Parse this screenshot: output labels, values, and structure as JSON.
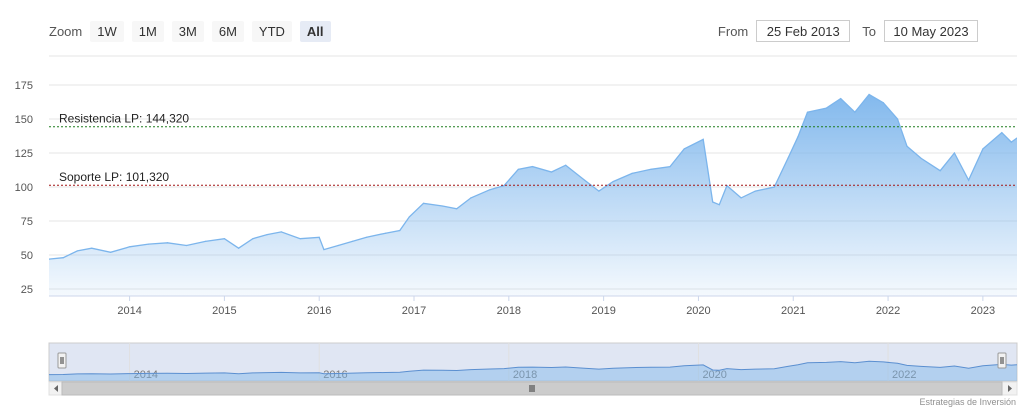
{
  "zoom": {
    "label": "Zoom",
    "buttons": [
      "1W",
      "1M",
      "3M",
      "6M",
      "YTD",
      "All"
    ],
    "active": "All"
  },
  "range": {
    "from_label": "From",
    "from_value": "25 Feb 2013",
    "to_label": "To",
    "to_value": "10 May 2023"
  },
  "credit": "Estrategias de Inversión",
  "colors": {
    "area_line": "#7cb5ec",
    "area_fill_top": "#7cb5ec",
    "resistance_line": "#1e7d1e",
    "support_line": "#a31515",
    "navigator_mask": "#c6d2ea"
  },
  "chart_data": {
    "type": "area",
    "title": "",
    "xlabel": "",
    "ylabel": "",
    "ylim": [
      25,
      175
    ],
    "yticks": [
      25,
      50,
      75,
      100,
      125,
      150,
      175
    ],
    "xlim": [
      2013.15,
      2023.36
    ],
    "xticks": [
      "2014",
      "2015",
      "2016",
      "2017",
      "2018",
      "2019",
      "2020",
      "2021",
      "2022",
      "2023"
    ],
    "grid": true,
    "series": [
      {
        "x": [
          2013.15,
          2013.3,
          2013.45,
          2013.6,
          2013.8,
          2014.0,
          2014.2,
          2014.4,
          2014.6,
          2014.8,
          2015.0,
          2015.15,
          2015.3,
          2015.45,
          2015.6,
          2015.8,
          2016.0,
          2016.05,
          2016.2,
          2016.35,
          2016.5,
          2016.7,
          2016.85,
          2016.95,
          2017.1,
          2017.3,
          2017.45,
          2017.6,
          2017.8,
          2017.95,
          2018.1,
          2018.25,
          2018.45,
          2018.6,
          2018.8,
          2018.95,
          2019.1,
          2019.3,
          2019.5,
          2019.7,
          2019.85,
          2020.05,
          2020.15,
          2020.22,
          2020.3,
          2020.45,
          2020.6,
          2020.8,
          2020.95,
          2021.05,
          2021.15,
          2021.35,
          2021.5,
          2021.65,
          2021.8,
          2021.95,
          2022.1,
          2022.2,
          2022.35,
          2022.55,
          2022.7,
          2022.85,
          2023.0,
          2023.2,
          2023.3,
          2023.36
        ],
        "values": [
          47,
          48,
          53,
          55,
          52,
          56,
          58,
          59,
          57,
          60,
          62,
          55,
          62,
          65,
          67,
          62,
          63,
          54,
          57,
          60,
          63,
          66,
          68,
          78,
          88,
          86,
          84,
          92,
          98,
          101,
          113,
          115,
          111,
          116,
          105,
          97,
          104,
          110,
          113,
          115,
          128,
          135,
          89,
          87,
          101,
          92,
          97,
          100,
          122,
          137,
          155,
          158,
          165,
          155,
          168,
          162,
          150,
          130,
          121,
          112,
          125,
          105,
          128,
          140,
          133,
          136
        ]
      }
    ],
    "annotations": [
      {
        "label": "Resistencia LP: 144,320",
        "y": 144.32
      },
      {
        "label": "Soporte LP: 101,320",
        "y": 101.32
      }
    ],
    "navigator_xticks": [
      "2014",
      "2016",
      "2018",
      "2020",
      "2022"
    ]
  }
}
